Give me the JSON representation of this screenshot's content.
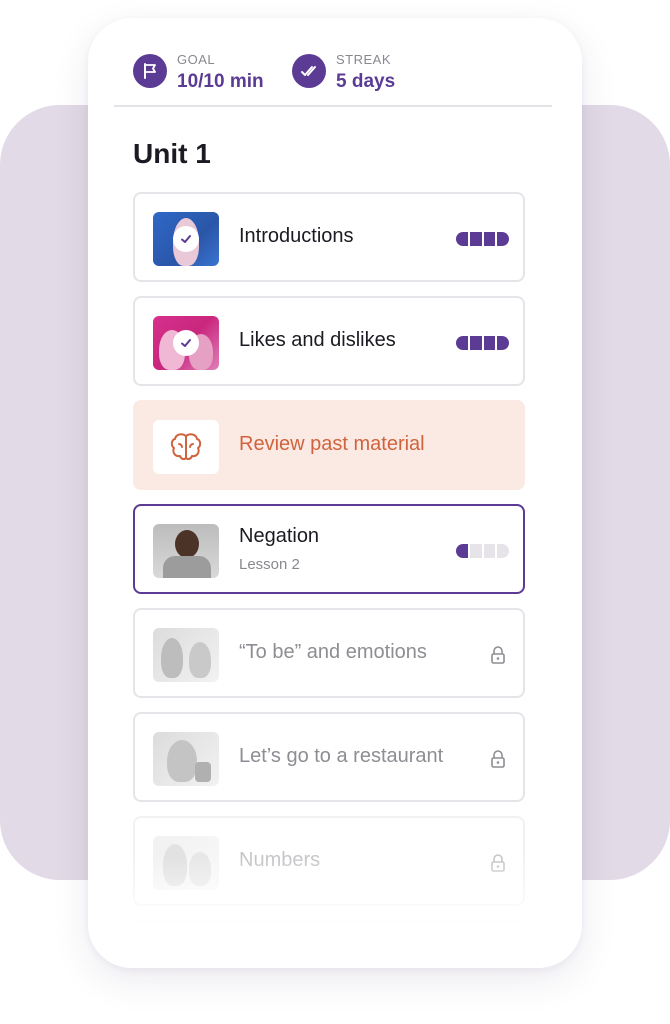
{
  "header": {
    "goal": {
      "label": "GOAL",
      "value": "10/10 min"
    },
    "streak": {
      "label": "STREAK",
      "value": "5 days"
    }
  },
  "unit": {
    "title": "Unit 1"
  },
  "lessons": [
    {
      "title": "Introductions",
      "state": "completed",
      "progress": 1.0
    },
    {
      "title": "Likes and dislikes",
      "state": "completed",
      "progress": 1.0
    },
    {
      "title": "Review past material",
      "state": "review",
      "icon": "brain-icon"
    },
    {
      "title": "Negation",
      "subtitle": "Lesson 2",
      "state": "in-progress",
      "progress": 0.25
    },
    {
      "title": "“To be” and emotions",
      "state": "locked"
    },
    {
      "title": "Let’s go to a restaurant",
      "state": "locked"
    },
    {
      "title": "Numbers",
      "state": "locked"
    }
  ],
  "colors": {
    "accent": "#5b3b94",
    "review_bg": "#fbe9e3",
    "review_text": "#d0633d",
    "background_panel": "#e2dae6"
  }
}
